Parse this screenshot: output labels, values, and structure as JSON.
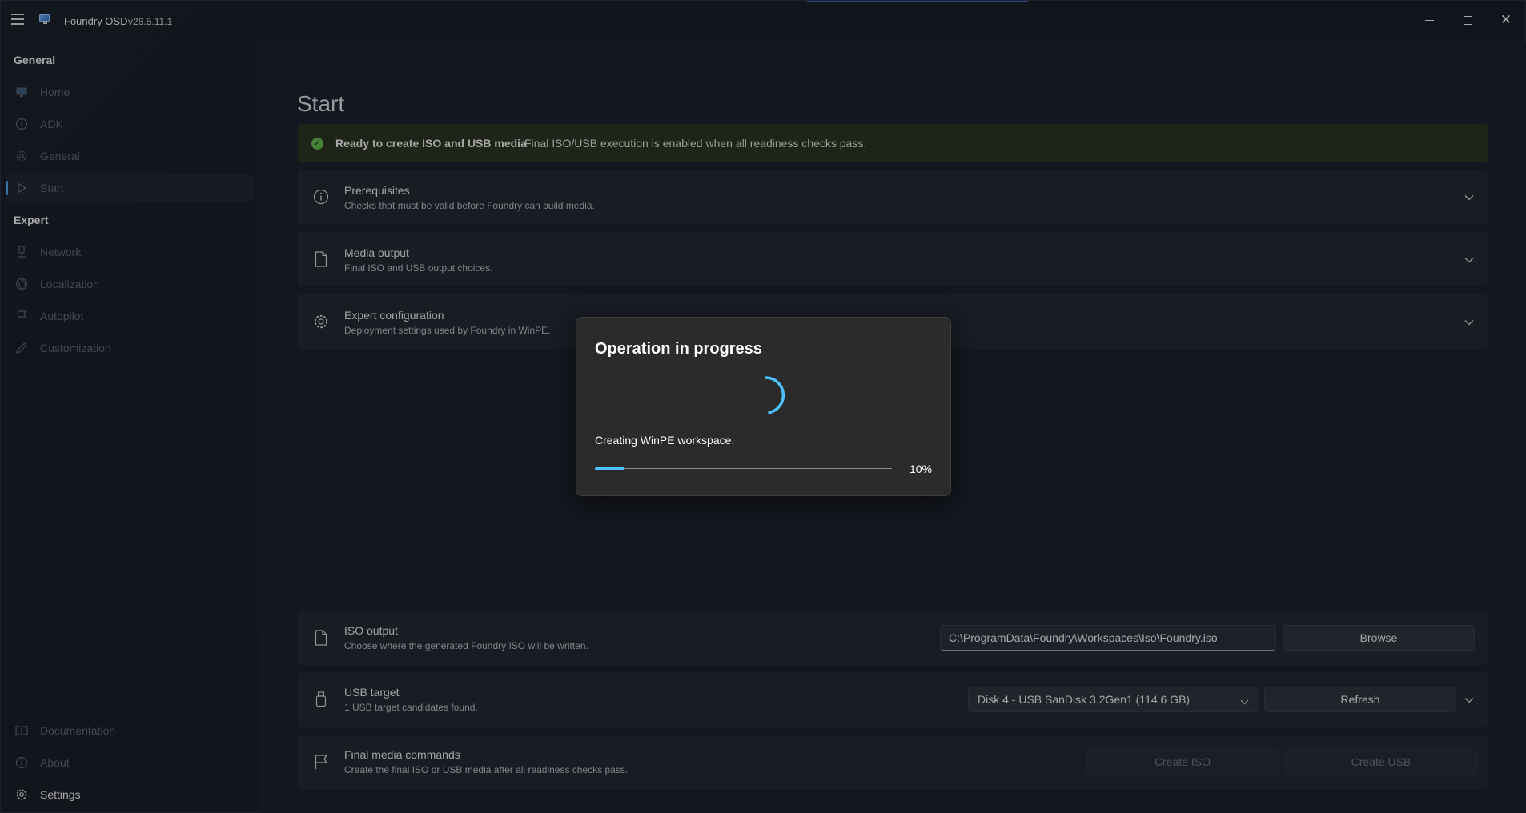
{
  "app": {
    "title": "Foundry OSD",
    "version": "v26.5.11.1"
  },
  "sidebar": {
    "general_header": "General",
    "expert_header": "Expert",
    "items": [
      {
        "label": "Home",
        "icon": "monitor-icon"
      },
      {
        "label": "ADK",
        "icon": "info-icon"
      },
      {
        "label": "General",
        "icon": "gear-icon"
      },
      {
        "label": "Start",
        "icon": "play-icon"
      },
      {
        "label": "Network",
        "icon": "network-icon"
      },
      {
        "label": "Localization",
        "icon": "globe-icon"
      },
      {
        "label": "Autopilot",
        "icon": "flag-icon"
      },
      {
        "label": "Customization",
        "icon": "pen-icon"
      }
    ],
    "footer_items": [
      {
        "label": "Documentation",
        "icon": "book-icon"
      },
      {
        "label": "About",
        "icon": "info-icon"
      },
      {
        "label": "Settings",
        "icon": "gear-icon"
      }
    ],
    "active": "Start"
  },
  "page": {
    "title": "Start",
    "banner": {
      "title": "Ready to create ISO and USB media",
      "text": "Final ISO/USB execution is enabled when all readiness checks pass."
    },
    "cards": [
      {
        "title": "Prerequisites",
        "subtitle": "Checks that must be valid before Foundry can build media."
      },
      {
        "title": "Media output",
        "subtitle": "Final ISO and USB output choices."
      },
      {
        "title": "Expert configuration",
        "subtitle": "Deployment settings used by Foundry in WinPE."
      }
    ],
    "iso_output": {
      "title": "ISO output",
      "subtitle": "Choose where the generated Foundry ISO will be written.",
      "path": "C:\\ProgramData\\Foundry\\Workspaces\\Iso\\Foundry.iso",
      "browse_label": "Browse"
    },
    "usb_target": {
      "title": "USB target",
      "subtitle": "1 USB target candidates found.",
      "selected": "Disk 4 - USB SanDisk 3.2Gen1 (114.6 GB)",
      "refresh_label": "Refresh"
    },
    "final_commands": {
      "title": "Final media commands",
      "subtitle": "Create the final ISO or USB media after all readiness checks pass.",
      "create_iso_label": "Create ISO",
      "create_usb_label": "Create USB"
    }
  },
  "dialog": {
    "title": "Operation in progress",
    "status": "Creating WinPE workspace.",
    "progress_percent": 10,
    "progress_label": "10%"
  },
  "colors": {
    "accent": "#4cc2ff",
    "banner_bg": "#2c3223",
    "success": "#5fb54a"
  }
}
